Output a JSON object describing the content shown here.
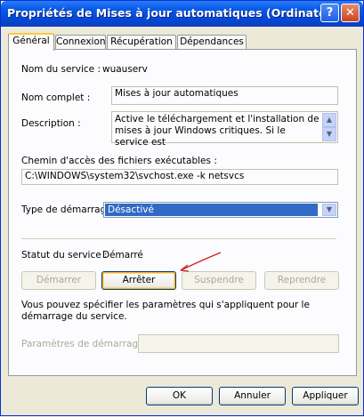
{
  "window": {
    "title": "Propriétés de Mises à jour automatiques (Ordinateur L..."
  },
  "titlebar": {
    "help_glyph": "?",
    "close_glyph": "✕"
  },
  "tabs": [
    {
      "label": "Général",
      "active": true
    },
    {
      "label": "Connexion",
      "active": false
    },
    {
      "label": "Récupération",
      "active": false
    },
    {
      "label": "Dépendances",
      "active": false
    }
  ],
  "general": {
    "service_name_label": "Nom du service :",
    "service_name_value": "wuauserv",
    "display_name_label": "Nom complet :",
    "display_name_value": "Mises à jour automatiques",
    "description_label": "Description :",
    "description_value": "Active le téléchargement et l'installation de mises à jour Windows critiques. Si le service est",
    "path_label": "Chemin d'accès des fichiers exécutables :",
    "path_value": "C:\\WINDOWS\\system32\\svchost.exe -k netsvcs",
    "startup_type_label": "Type de démarrage :",
    "startup_type_value": "Désactivé",
    "status_label": "Statut du service :",
    "status_value": "Démarré",
    "info_text": "Vous pouvez spécifier les paramètres qui s'appliquent pour le démarrage du service.",
    "start_params_label": "Paramètres de démarrage :",
    "start_params_value": ""
  },
  "service_buttons": {
    "start": "Démarrer",
    "stop": "Arrêter",
    "pause": "Suspendre",
    "resume": "Reprendre"
  },
  "dialog_buttons": {
    "ok": "OK",
    "cancel": "Annuler",
    "apply": "Appliquer"
  },
  "colors": {
    "titlebar": "#0A5BE8",
    "selection": "#316AC5",
    "annotation_arrow": "#D02020"
  }
}
